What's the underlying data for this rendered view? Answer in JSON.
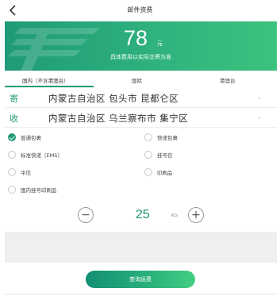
{
  "nav": {
    "title": "邮件资费"
  },
  "banner": {
    "amount": "78",
    "unit": "元",
    "note": "具体费用以实际交寄为准",
    "colors": {
      "start": "#1f9a77",
      "end": "#3cc27f"
    }
  },
  "tabs": [
    {
      "label": "国内（不含港澳台）",
      "active": true
    },
    {
      "label": "国际",
      "active": false
    },
    {
      "label": "港澳台",
      "active": false
    }
  ],
  "sender": {
    "tag": "寄",
    "address": "内蒙古自治区 包头市 昆都仑区"
  },
  "receiver": {
    "tag": "收",
    "address": "内蒙古自治区 乌兰察布市 集宁区"
  },
  "services": [
    {
      "label": "普通包裹",
      "checked": true
    },
    {
      "label": "快递包裹",
      "checked": false
    },
    {
      "label": "标准快递（EMS）",
      "checked": false
    },
    {
      "label": "挂号信",
      "checked": false
    },
    {
      "label": "平信",
      "checked": false
    },
    {
      "label": "印刷品",
      "checked": false
    },
    {
      "label": "国内挂号印刷品",
      "checked": false
    }
  ],
  "weight": {
    "value": "25",
    "unit": "KG",
    "minus": "−",
    "plus": "+"
  },
  "query_button": {
    "label": "查询运费"
  }
}
